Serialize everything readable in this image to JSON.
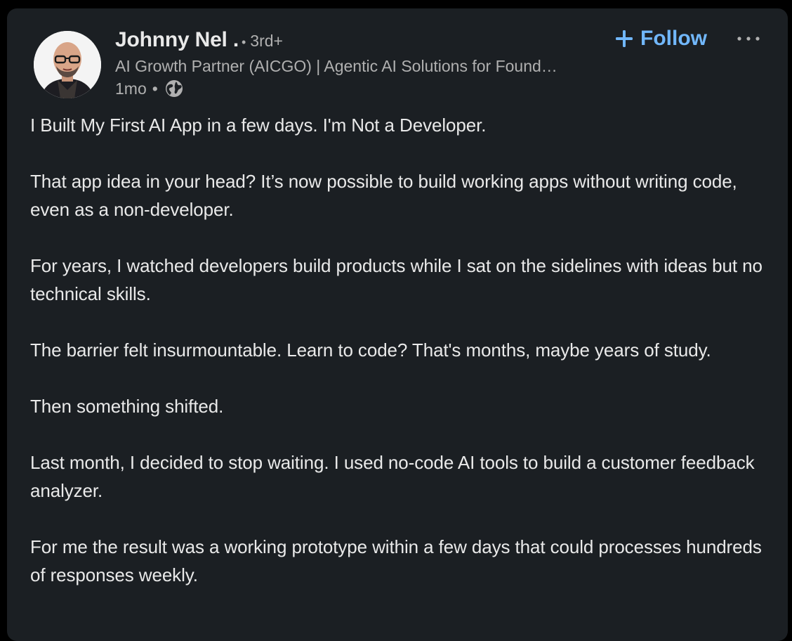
{
  "author": {
    "name": "Johnny Nel .",
    "degree_separator": "•",
    "degree": "3rd+",
    "headline": "AI Growth Partner (AICGO) | Agentic AI Solutions for Found…",
    "time": "1mo",
    "time_separator": "•",
    "visibility_icon": "globe-icon"
  },
  "actions": {
    "follow_label": "Follow",
    "follow_icon": "plus-icon",
    "more_icon": "ellipsis-icon"
  },
  "post": {
    "paragraphs": [
      "I Built My First AI App in a few days. I'm Not a Developer.",
      "That app idea in your head? It’s now possible to build working apps without writing code, even as a non-developer.",
      "For years, I watched developers build products while I sat on the sidelines with ideas but no technical skills.",
      "The barrier felt insurmountable. Learn to code? That's months, maybe years of study.",
      "Then something shifted.",
      "Last month, I decided to stop waiting. I used no-code AI tools to build a customer feedback analyzer.",
      "For me the result was a working prototype within a few days that could processes hundreds of responses weekly."
    ]
  },
  "colors": {
    "card_background": "#1b1f23",
    "page_background": "#000000",
    "primary_text": "#e9e9e9",
    "secondary_text": "#b0b0b0",
    "accent": "#71b7fb"
  }
}
